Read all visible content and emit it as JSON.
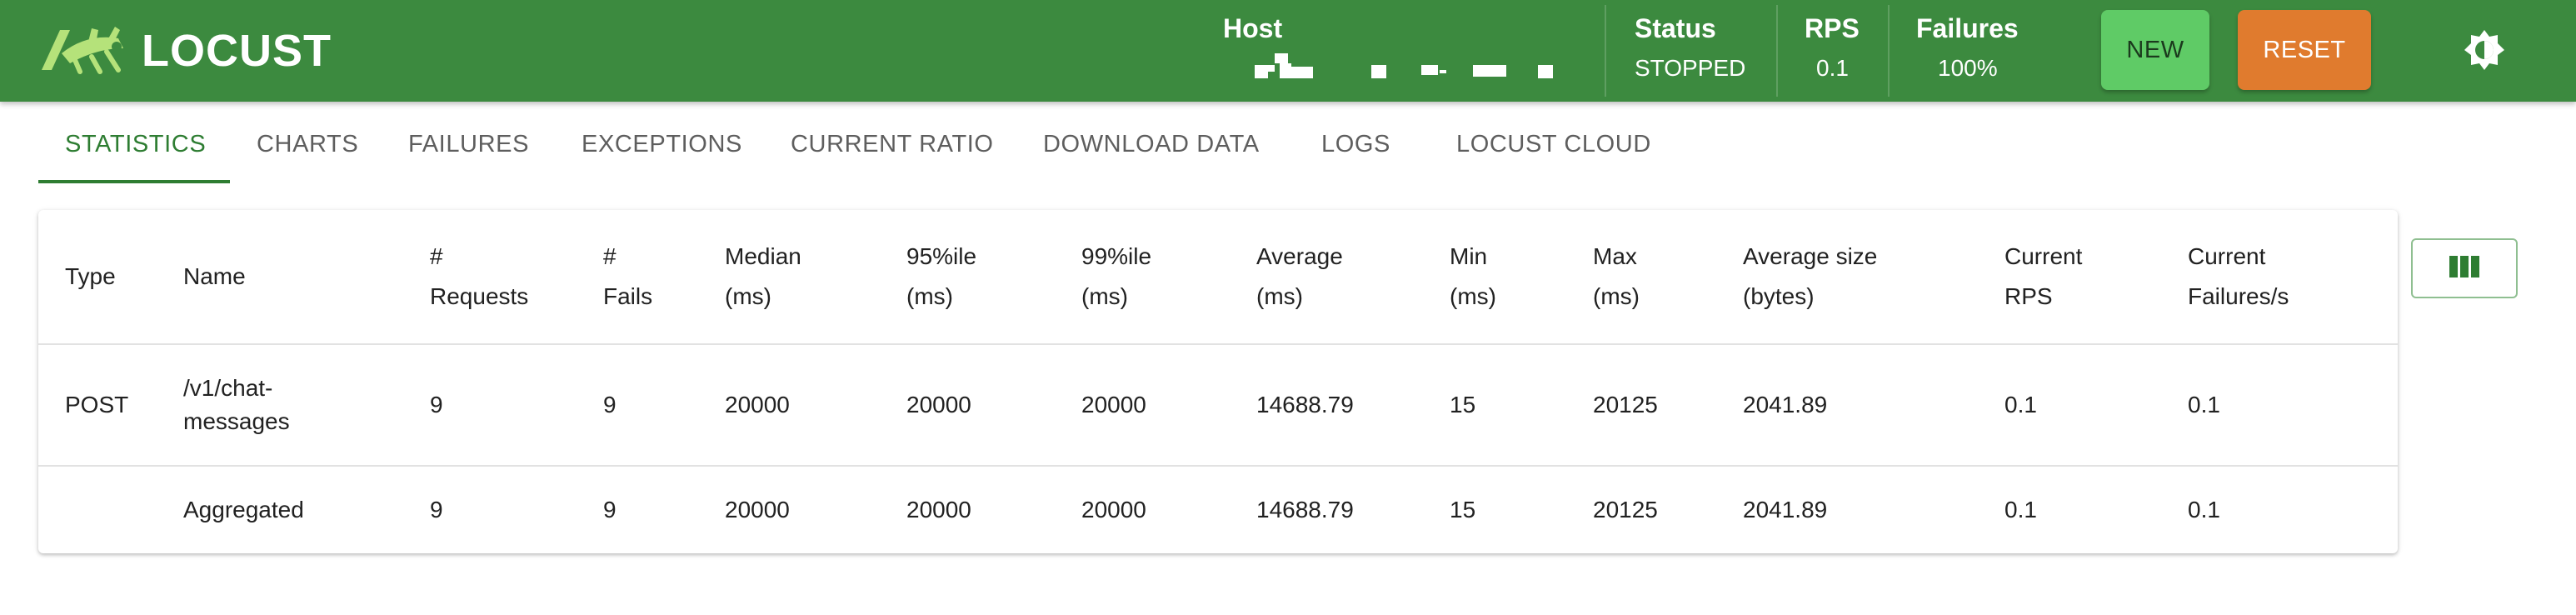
{
  "brand": {
    "name": "LOCUST",
    "logo_icon": "locust-logo-icon"
  },
  "header": {
    "host_label": "Host",
    "status_label": "Status",
    "status_value": "STOPPED",
    "rps_label": "RPS",
    "rps_value": "0.1",
    "failures_label": "Failures",
    "failures_value": "100%",
    "new_button": "NEW",
    "reset_button": "RESET",
    "theme_icon": "brightness-icon"
  },
  "colors": {
    "header_bg": "#3c8a3f",
    "new_button": "#5fcb66",
    "reset_button": "#e07b2e",
    "active_tab": "#2e7d32"
  },
  "tabs": [
    {
      "label": "STATISTICS",
      "active": true
    },
    {
      "label": "CHARTS"
    },
    {
      "label": "FAILURES"
    },
    {
      "label": "EXCEPTIONS"
    },
    {
      "label": "CURRENT RATIO"
    },
    {
      "label": "DOWNLOAD DATA"
    },
    {
      "label": "LOGS"
    },
    {
      "label": "LOCUST CLOUD"
    }
  ],
  "table": {
    "columns": [
      {
        "line1": "Type",
        "line2": ""
      },
      {
        "line1": "Name",
        "line2": ""
      },
      {
        "line1": "#",
        "line2": "Requests"
      },
      {
        "line1": "#",
        "line2": "Fails"
      },
      {
        "line1": "Median",
        "line2": "(ms)"
      },
      {
        "line1": "95%ile",
        "line2": "(ms)"
      },
      {
        "line1": "99%ile",
        "line2": "(ms)"
      },
      {
        "line1": "Average",
        "line2": "(ms)"
      },
      {
        "line1": "Min",
        "line2": "(ms)"
      },
      {
        "line1": "Max",
        "line2": "(ms)"
      },
      {
        "line1": "Average size",
        "line2": "(bytes)"
      },
      {
        "line1": "Current",
        "line2": "RPS"
      },
      {
        "line1": "Current",
        "line2": "Failures/s"
      }
    ],
    "rows": [
      [
        "POST",
        "/v1/chat-messages",
        "9",
        "9",
        "20000",
        "20000",
        "20000",
        "14688.79",
        "15",
        "20125",
        "2041.89",
        "0.1",
        "0.1"
      ],
      [
        "",
        "Aggregated",
        "9",
        "9",
        "20000",
        "20000",
        "20000",
        "14688.79",
        "15",
        "20125",
        "2041.89",
        "0.1",
        "0.1"
      ]
    ],
    "columns_button_icon": "view-column-icon"
  }
}
